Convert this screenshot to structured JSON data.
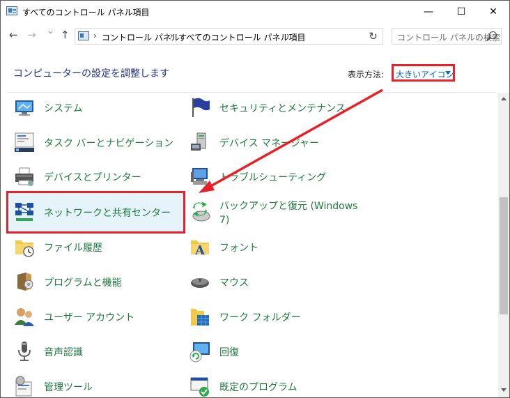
{
  "window": {
    "title": "すべてのコントロール パネル項目",
    "minimize": "—",
    "maximize": "☐",
    "close": "✕"
  },
  "nav": {
    "back": "←",
    "forward": "→",
    "dropdown": "⌄",
    "up": "↑"
  },
  "address": {
    "sep1": "›",
    "crumb1": "コントロール パネル",
    "sep2": "›",
    "crumb2": "すべてのコントロール パネル項目",
    "sep3": "›",
    "refresh": "↻"
  },
  "search": {
    "placeholder": "コントロール パネルの検索"
  },
  "header": {
    "title": "コンピューターの設定を調整します",
    "view_label": "表示方法:",
    "view_value": "大きいアイコン"
  },
  "items_left": [
    {
      "label": "システム",
      "icon": "system-monitor-icon"
    },
    {
      "label": "タスク バーとナビゲーション",
      "icon": "taskbar-icon"
    },
    {
      "label": "デバイスとプリンター",
      "icon": "printer-icon"
    },
    {
      "label": "ネットワークと共有センター",
      "icon": "network-icon"
    },
    {
      "label": "ファイル履歴",
      "icon": "file-history-icon"
    },
    {
      "label": "プログラムと機能",
      "icon": "programs-icon"
    },
    {
      "label": "ユーザー アカウント",
      "icon": "users-icon"
    },
    {
      "label": "音声認識",
      "icon": "microphone-icon"
    },
    {
      "label": "管理ツール",
      "icon": "admin-tools-icon"
    }
  ],
  "items_right": [
    {
      "label": "セキュリティとメンテナンス",
      "icon": "security-flag-icon"
    },
    {
      "label": "デバイス マネージャー",
      "icon": "device-manager-icon"
    },
    {
      "label": "トラブルシューティング",
      "icon": "troubleshoot-icon"
    },
    {
      "label": "バックアップと復元 (Windows 7)",
      "icon": "backup-icon"
    },
    {
      "label": "フォント",
      "icon": "font-folder-icon"
    },
    {
      "label": "マウス",
      "icon": "mouse-icon"
    },
    {
      "label": "ワーク フォルダー",
      "icon": "work-folder-icon"
    },
    {
      "label": "回復",
      "icon": "recovery-icon"
    },
    {
      "label": "既定のプログラム",
      "icon": "default-programs-icon"
    }
  ],
  "colors": {
    "link_green": "#1e7a3c",
    "heading_blue": "#1e3287",
    "accent_blue": "#0066cc",
    "annotation_red": "#e8202a",
    "selection_bg": "#e5f3fb"
  }
}
